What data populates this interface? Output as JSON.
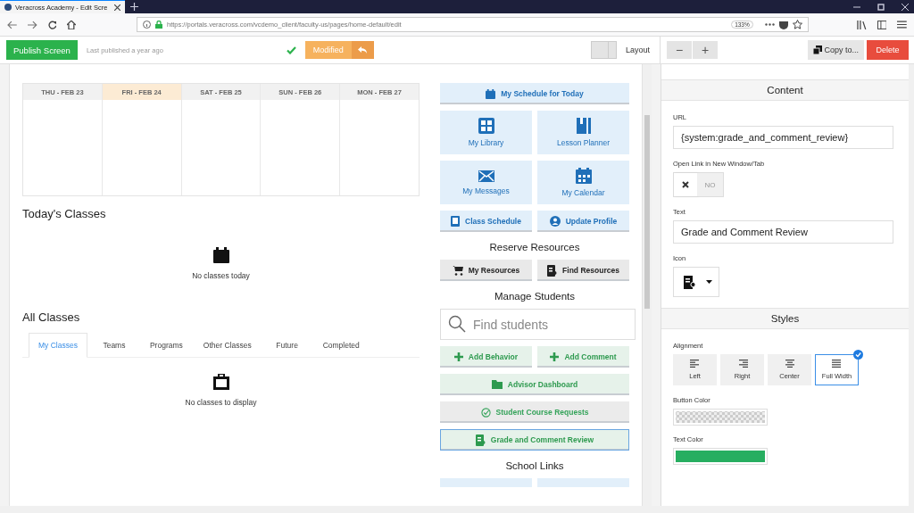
{
  "browser": {
    "tab_title": "Veracross Academy - Edit Scre",
    "url": "https://portals.veracross.com/vcdemo_client/faculty-us/pages/home-default/edit",
    "zoom": "133%"
  },
  "toolbar": {
    "publish_button": "Publish Screen",
    "last_published": "Last published a year ago",
    "modified_button": "Modified",
    "layout_split": {
      "level": 0.65
    },
    "layout_label": "Layout",
    "zoom_out": "−",
    "zoom_in": "+",
    "copy_button": "Copy to...",
    "delete_button": "Delete"
  },
  "calendar": {
    "days": [
      {
        "label": "THU - FEB 23",
        "selected": false
      },
      {
        "label": "FRI - FEB 24",
        "selected": true
      },
      {
        "label": "SAT - FEB 25",
        "selected": false
      },
      {
        "label": "SUN - FEB 26",
        "selected": false
      },
      {
        "label": "MON - FEB 27",
        "selected": false
      }
    ]
  },
  "todays_classes": {
    "title": "Today's Classes",
    "empty_text": "No classes today"
  },
  "all_classes": {
    "title": "All Classes",
    "tabs": [
      {
        "label": "My Classes",
        "selected": true
      },
      {
        "label": "Teams",
        "selected": false
      },
      {
        "label": "Programs",
        "selected": false
      },
      {
        "label": "Other Classes",
        "selected": false
      },
      {
        "label": "Future",
        "selected": false
      },
      {
        "label": "Completed",
        "selected": false
      }
    ],
    "empty_text": "No classes to display"
  },
  "portal": {
    "groups": [
      {
        "items": [
          {
            "kind": "wide",
            "label": "My Schedule for Today",
            "selected": false
          },
          {
            "kind": "tile",
            "label": "My Library",
            "selected": false
          },
          {
            "kind": "tile",
            "label": "Lesson Planner",
            "selected": false
          },
          {
            "kind": "tile",
            "label": "My Messages",
            "selected": false
          },
          {
            "kind": "tile",
            "label": "My Calendar",
            "selected": false
          },
          {
            "kind": "half",
            "label": "Class Schedule",
            "selected": false
          },
          {
            "kind": "half",
            "label": "Update Profile",
            "selected": false
          }
        ]
      },
      {
        "heading": "Reserve Resources",
        "items": [
          {
            "kind": "half",
            "label": "My Resources",
            "selected": false
          },
          {
            "kind": "half",
            "label": "Find Resources",
            "selected": false
          }
        ]
      },
      {
        "heading": "Manage Students",
        "items": [
          {
            "kind": "search",
            "placeholder": "Find students"
          },
          {
            "kind": "half",
            "label": "Add Behavior",
            "selected": false
          },
          {
            "kind": "half",
            "label": "Add Comment",
            "selected": false
          },
          {
            "kind": "wide",
            "label": "Advisor Dashboard",
            "selected": false
          },
          {
            "kind": "wide",
            "label": "Student Course Requests",
            "selected": false
          },
          {
            "kind": "wide",
            "label": "Grade and Comment Review",
            "selected": true
          }
        ]
      },
      {
        "heading": "School Links",
        "items": [
          {
            "kind": "half",
            "selected": false
          },
          {
            "kind": "half",
            "selected": false
          }
        ]
      }
    ]
  },
  "properties": {
    "content": {
      "heading": "Content",
      "url_label": "URL",
      "url_value": "{system:grade_and_comment_review}",
      "new_window_label": "Open Link in New Window/Tab",
      "new_window_on": false,
      "new_window_state": "NO",
      "text_label": "Text",
      "text_value": "Grade and Comment Review",
      "icon_label": "Icon"
    },
    "styles": {
      "heading": "Styles",
      "alignment_label": "Alignment",
      "alignments": [
        {
          "label": "Left",
          "selected": false
        },
        {
          "label": "Right",
          "selected": false
        },
        {
          "label": "Center",
          "selected": false
        },
        {
          "label": "Full Width",
          "selected": true
        }
      ],
      "button_color_label": "Button Color",
      "text_color_label": "Text Color"
    }
  }
}
